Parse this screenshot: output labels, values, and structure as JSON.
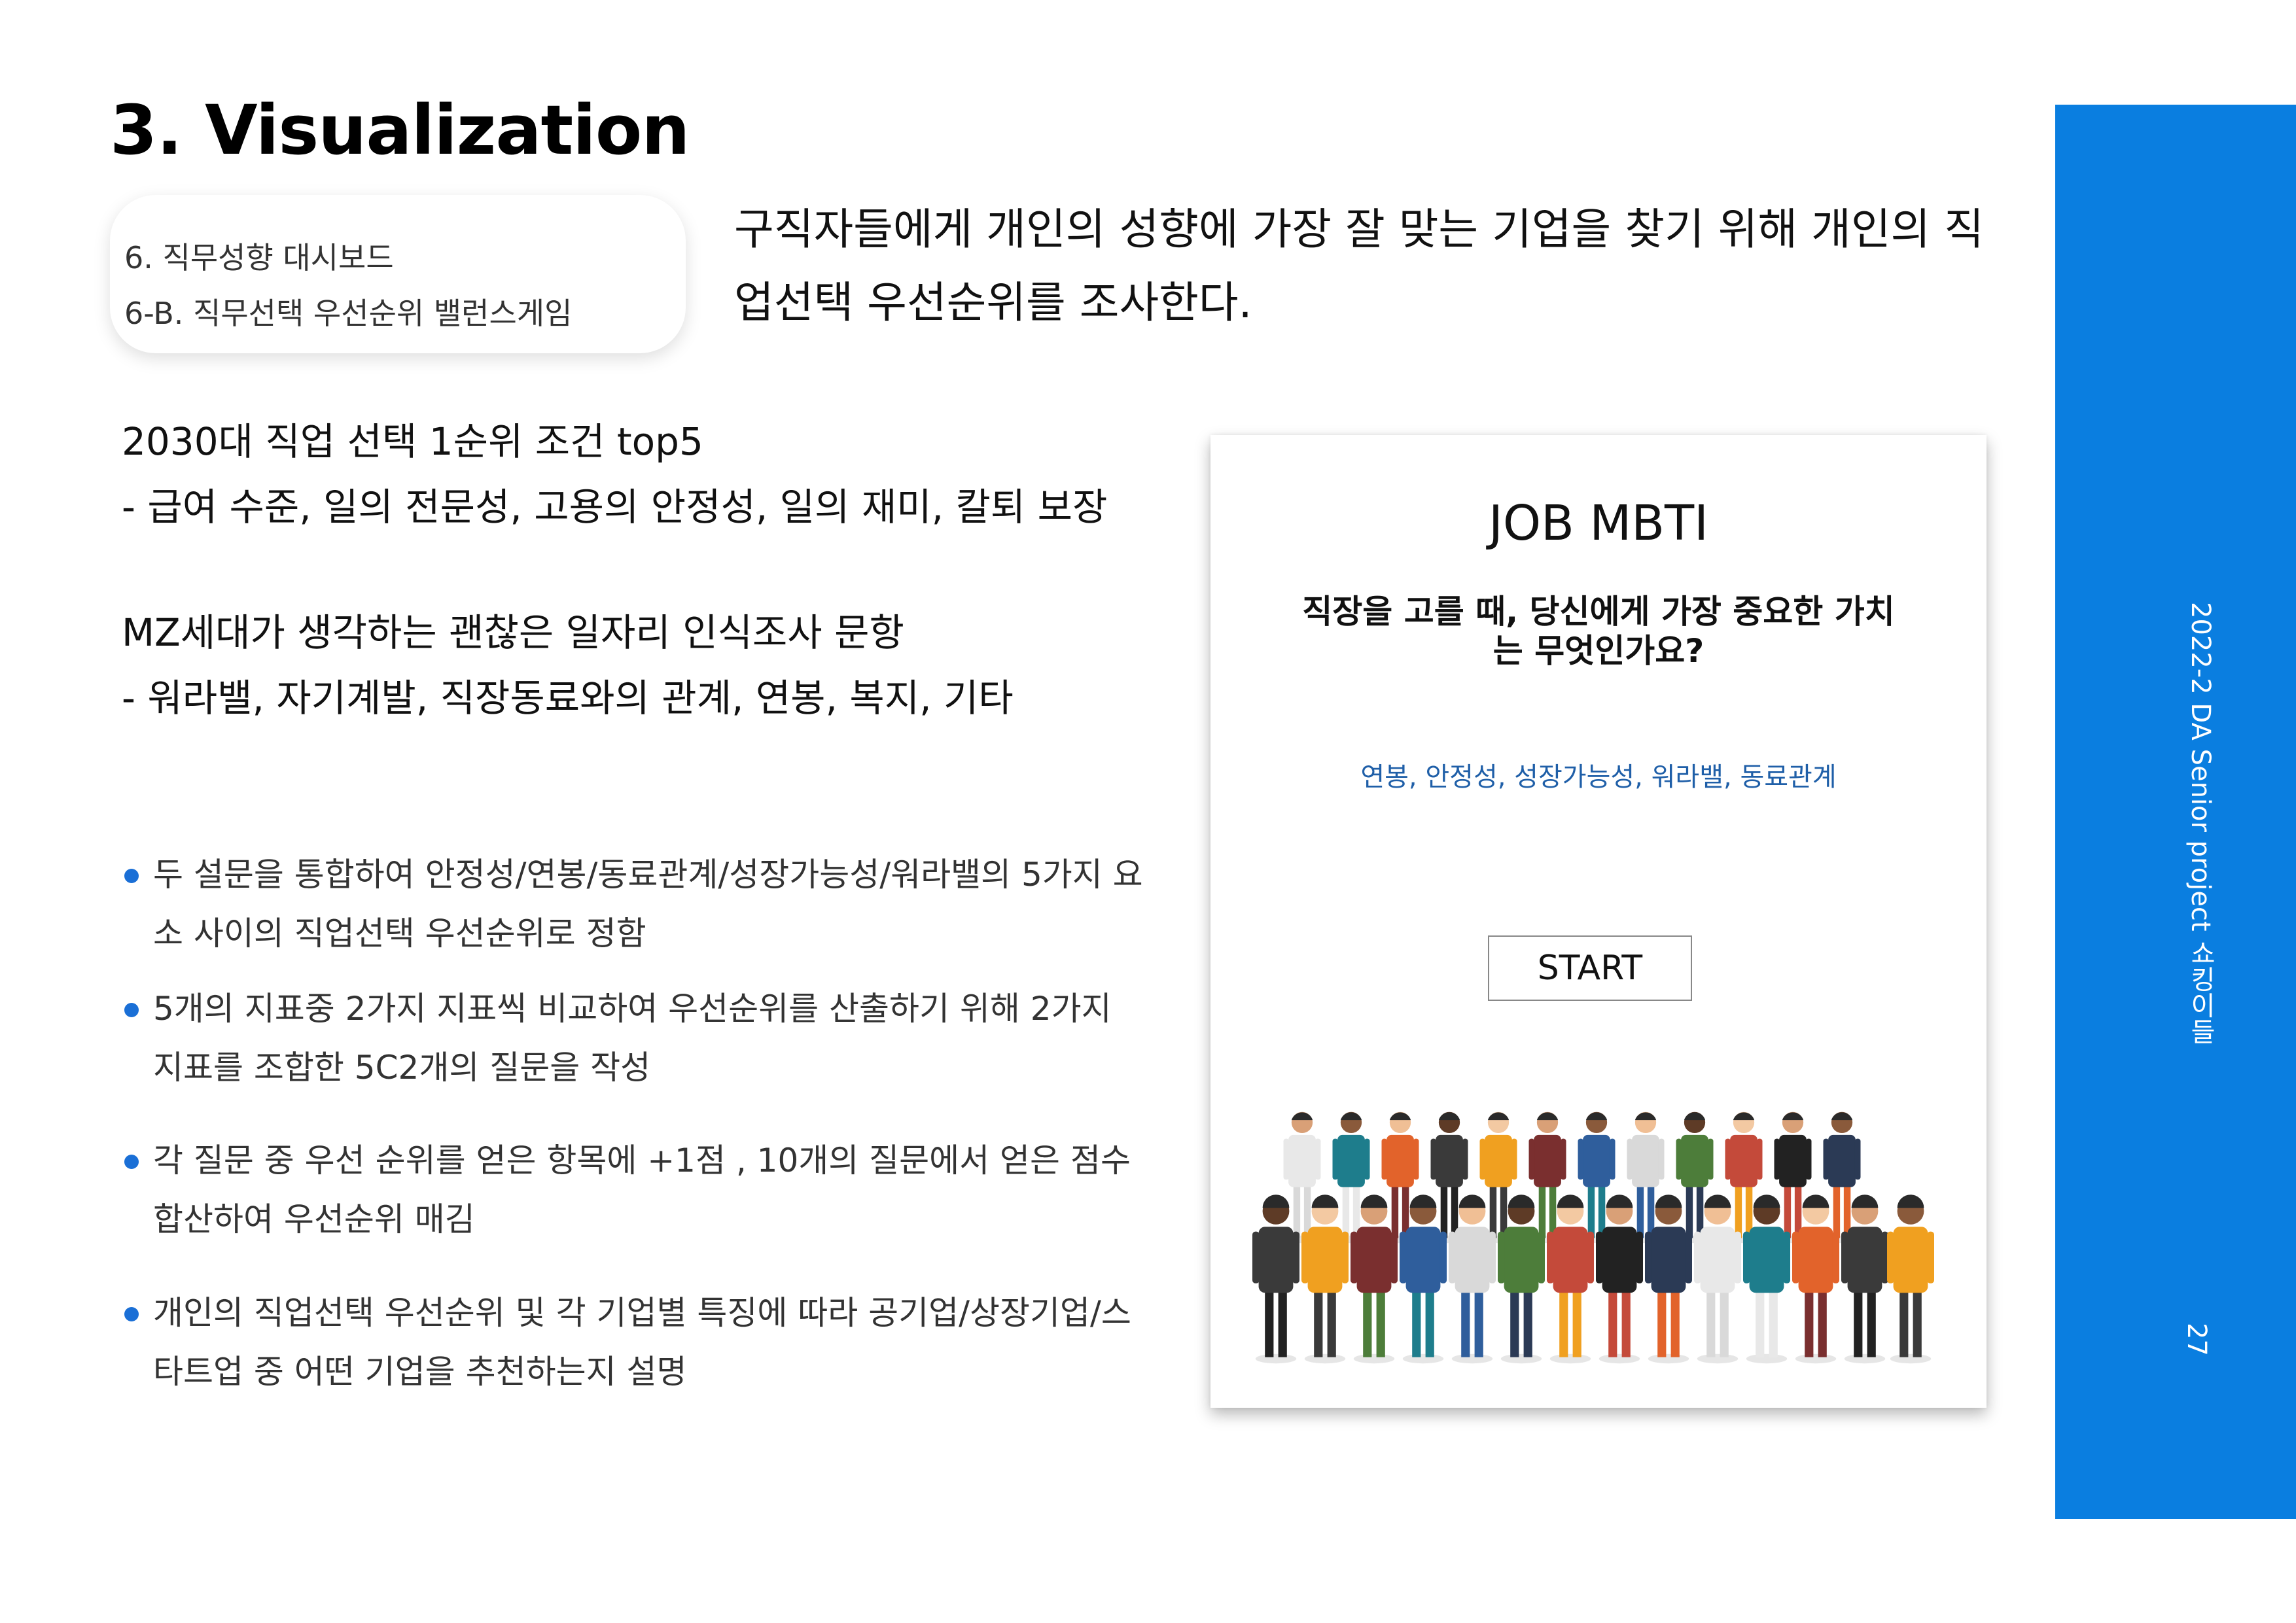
{
  "slide": {
    "title": "3. Visualization",
    "nav": {
      "line1": "6. 직무성향 대시보드",
      "line2": "6-B. 직무선택 우선순위 밸런스게임"
    },
    "intro": "구직자들에게 개인의 성향에 가장 잘 맞는 기업을 찾기 위해 개인의 직업선택 우선순위를 조사한다.",
    "section1": {
      "heading": "2030대 직업 선택 1순위 조건 top5",
      "body": "- 급여 수준, 일의 전문성, 고용의 안정성, 일의 재미, 칼퇴 보장"
    },
    "section2": {
      "heading": "MZ세대가 생각하는 괜찮은 일자리 인식조사 문항",
      "body": "- 워라밸, 자기계발, 직장동료와의 관계, 연봉, 복지, 기타"
    },
    "bullets": [
      "두 설문을 통합하여 안정성/연봉/동료관계/성장가능성/워라밸의 5가지 요소 사이의 직업선택 우선순위로 정함",
      "5개의 지표중 2가지 지표씩 비교하여 우선순위를 산출하기 위해 2가지 지표를 조합한 5C2개의 질문을 작성",
      "각 질문 중 우선 순위를 얻은 항목에 +1점 , 10개의 질문에서 얻은 점수 합산하여 우선순위 매김",
      "개인의 직업선택 우선순위 및 각 기업별 특징에 따라 공기업/상장기업/스타트업 중 어떤 기업을 추천하는지 설명"
    ],
    "sidebar_text": "2022-2 DA Senior project 쇼킹이들",
    "page_number": "27",
    "accent_color": "#0a7ee0"
  },
  "app": {
    "title": "JOB MBTI",
    "question": "직장을 고를 때, 당신에게 가장 중요한 가치는 무엇인가요?",
    "options": "연봉, 안정성, 성장가능성, 워라밸, 동료관계",
    "start_label": "START",
    "illustration": "diverse-workers-crowd-illustration"
  }
}
